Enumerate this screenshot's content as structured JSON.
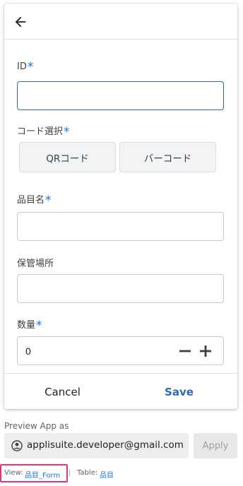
{
  "form": {
    "fields": [
      {
        "label": "ID",
        "required": "*",
        "value": ""
      },
      {
        "label": "コード選択",
        "required": "*",
        "options": [
          "QRコード",
          "バーコード"
        ]
      },
      {
        "label": "品目名",
        "required": "*",
        "value": ""
      },
      {
        "label": "保管場所",
        "required": "",
        "value": ""
      },
      {
        "label": "数量",
        "required": "*",
        "value": "0"
      }
    ]
  },
  "actions": {
    "cancel_label": "Cancel",
    "save_label": "Save"
  },
  "preview": {
    "label": "Preview App as",
    "email": "applisuite.developer@gmail.com",
    "apply_label": "Apply"
  },
  "footer": {
    "view_label": "View:",
    "view_value": "品目_Form",
    "separator": "|",
    "table_label": "Table:",
    "table_value": "品目"
  },
  "colors": {
    "accent": "#2d6ab3",
    "required": "#1a73e8",
    "highlight": "#e0357a"
  }
}
